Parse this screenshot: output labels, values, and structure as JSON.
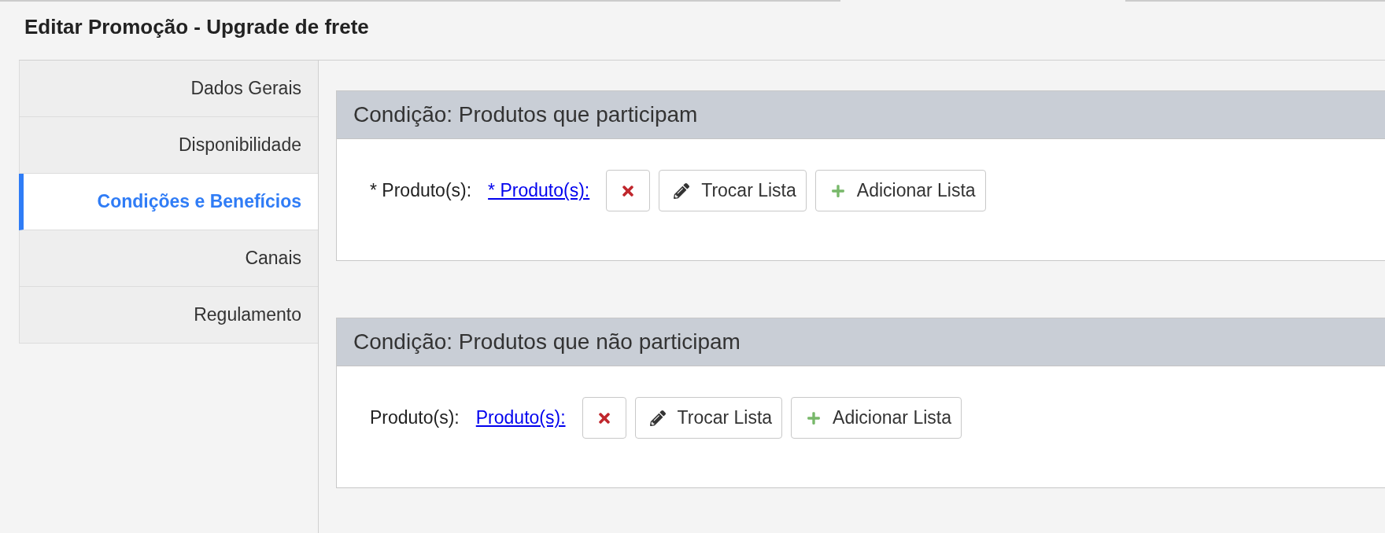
{
  "title": "Editar Promoção - Upgrade de frete",
  "sidebar": {
    "items": [
      {
        "label": "Dados Gerais",
        "selected": false
      },
      {
        "label": "Disponibilidade",
        "selected": false
      },
      {
        "label": "Condições e Benefícios",
        "selected": true
      },
      {
        "label": "Canais",
        "selected": false
      },
      {
        "label": "Regulamento",
        "selected": false
      }
    ]
  },
  "conditions": [
    {
      "title": "Condição: Produtos que participam",
      "field_label": "* Produto(s):",
      "link": "* Produto(s):",
      "buttons": [
        {
          "kind": "remove"
        },
        {
          "kind": "edit",
          "label": "Trocar Lista"
        },
        {
          "kind": "add",
          "label": "Adicionar Lista"
        }
      ]
    },
    {
      "title": "Condição: Produtos que não participam",
      "field_label": "Produto(s):",
      "link": "Produto(s):",
      "buttons": [
        {
          "kind": "remove"
        },
        {
          "kind": "edit",
          "label": "Trocar Lista"
        },
        {
          "kind": "add",
          "label": "Adicionar Lista"
        }
      ]
    }
  ]
}
